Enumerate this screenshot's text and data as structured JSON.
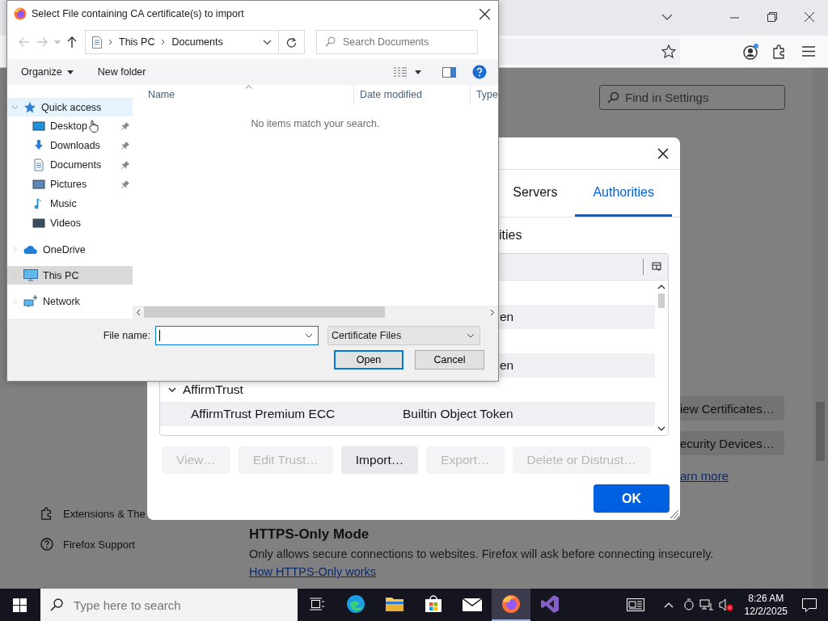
{
  "browser": {
    "find_field": {
      "placeholder": "Find in Settings"
    },
    "nav": [
      {
        "label": "Extensions & The",
        "kind": "extensions"
      },
      {
        "label": "Firefox Support",
        "kind": "support"
      }
    ],
    "section": {
      "heading": "HTTPS-Only Mode",
      "description": "Only allows secure connections to websites. Firefox will ask before connecting insecurely.",
      "link": "How HTTPS-Only works"
    },
    "side_buttons": [
      "iew Certificates…",
      "ecurity Devices…"
    ],
    "side_link": "arn more"
  },
  "cert_dialog": {
    "tabs": [
      {
        "label": "Servers",
        "selected": false
      },
      {
        "label": "Authorities",
        "selected": true
      }
    ],
    "caption": "ities",
    "rows": [
      {
        "kind": "blank"
      },
      {
        "kind": "fragment",
        "token": "en"
      },
      {
        "kind": "blank"
      },
      {
        "kind": "fragment",
        "token": "en"
      },
      {
        "kind": "group",
        "name": "AffirmTrust",
        "expanded": true
      },
      {
        "kind": "cert",
        "name": "AffirmTrust Premium ECC",
        "token": "Builtin Object Token"
      }
    ],
    "buttons": [
      {
        "label": "View…",
        "disabled": true
      },
      {
        "label": "Edit Trust…",
        "disabled": true
      },
      {
        "label": "Import…",
        "disabled": false
      },
      {
        "label": "Export…",
        "disabled": true
      },
      {
        "label": "Delete or Distrust…",
        "disabled": true
      }
    ],
    "ok": "OK"
  },
  "file_dialog": {
    "title": "Select File containing CA certificate(s) to import",
    "path": [
      "This PC",
      "Documents"
    ],
    "search": {
      "placeholder": "Search Documents"
    },
    "organize": "Organize",
    "new_folder": "New folder",
    "tree": [
      {
        "label": "Quick access",
        "kind": "quick-access",
        "expanded": true,
        "hovered": true,
        "selected": false,
        "children": [
          {
            "label": "Desktop",
            "kind": "desktop",
            "pinned": true,
            "selected": false
          },
          {
            "label": "Downloads",
            "kind": "downloads",
            "pinned": true,
            "selected": false
          },
          {
            "label": "Documents",
            "kind": "documents",
            "pinned": true,
            "selected": false
          },
          {
            "label": "Pictures",
            "kind": "pictures",
            "pinned": true,
            "selected": false
          },
          {
            "label": "Music",
            "kind": "music",
            "pinned": false,
            "selected": false
          },
          {
            "label": "Videos",
            "kind": "videos",
            "pinned": false,
            "selected": false
          }
        ]
      },
      {
        "label": "OneDrive",
        "kind": "onedrive",
        "expanded": false,
        "hovered": false,
        "selected": false
      },
      {
        "label": "This PC",
        "kind": "this-pc",
        "expanded": false,
        "hovered": false,
        "selected": true
      },
      {
        "label": "Network",
        "kind": "network",
        "expanded": false,
        "hovered": false,
        "selected": false
      }
    ],
    "columns": [
      "Name",
      "Date modified",
      "Type"
    ],
    "empty_message": "No items match your search.",
    "file_name_label": "File name:",
    "filter": "Certificate Files",
    "buttons": [
      {
        "label": "Open",
        "default": true
      },
      {
        "label": "Cancel",
        "default": false
      }
    ]
  },
  "taskbar": {
    "search": {
      "placeholder": "Type here to search"
    },
    "apps": [
      {
        "kind": "task-view",
        "active": false
      },
      {
        "kind": "edge",
        "active": false
      },
      {
        "kind": "files",
        "active": false
      },
      {
        "kind": "store",
        "active": false
      },
      {
        "kind": "mail",
        "active": false
      },
      {
        "kind": "firefox",
        "active": true
      },
      {
        "kind": "studio",
        "active": false
      }
    ],
    "time": "8:26 AM",
    "date": "12/2/2025"
  }
}
